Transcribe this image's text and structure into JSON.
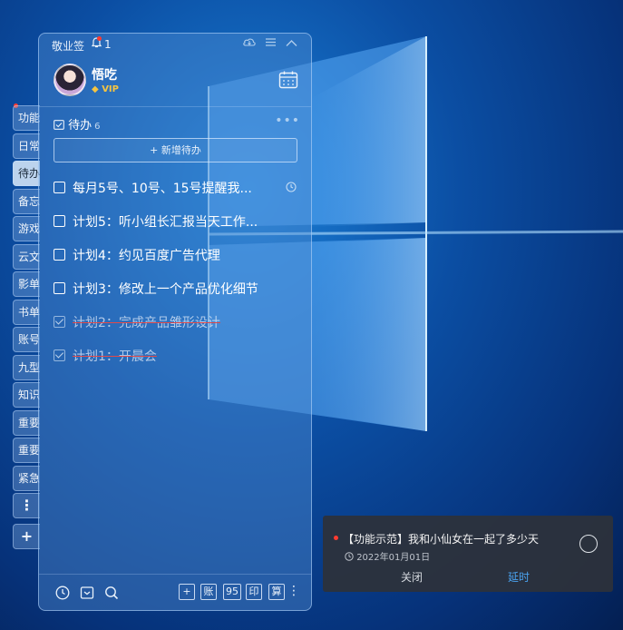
{
  "app": {
    "name": "敬业签",
    "notification_count": "1"
  },
  "profile": {
    "username": "悟吃",
    "badge": "VIP"
  },
  "side_tabs": [
    {
      "label": "功能",
      "active": false
    },
    {
      "label": "日常",
      "active": false
    },
    {
      "label": "待办",
      "active": true
    },
    {
      "label": "备忘",
      "active": false
    },
    {
      "label": "游戏",
      "active": false
    },
    {
      "label": "云文",
      "active": false
    },
    {
      "label": "影单",
      "active": false
    },
    {
      "label": "书单",
      "active": false
    },
    {
      "label": "账号",
      "active": false
    },
    {
      "label": "九型",
      "active": false
    },
    {
      "label": "知识",
      "active": false
    },
    {
      "label": "重要",
      "active": false
    },
    {
      "label": "重要",
      "active": false
    },
    {
      "label": "紧急",
      "active": false
    }
  ],
  "side_more": "⋮",
  "side_add": "+",
  "section": {
    "title": "待办",
    "count": "6",
    "add_label": "+ 新增待办"
  },
  "todos": [
    {
      "text": "每月5号、10号、15号提醒我...",
      "done": false,
      "reminder": true
    },
    {
      "text": "计划5：听小组长汇报当天工作...",
      "done": false,
      "reminder": false
    },
    {
      "text": "计划4：约见百度广告代理",
      "done": false,
      "reminder": false
    },
    {
      "text": "计划3：修改上一个产品优化细节",
      "done": false,
      "reminder": false
    },
    {
      "text": "计划2：完成产品雏形设计",
      "done": true,
      "reminder": false
    },
    {
      "text": "计划1：开晨会",
      "done": true,
      "reminder": false
    }
  ],
  "bottom_bar": {
    "add": "+",
    "ledger": "账",
    "num": "95",
    "print": "印",
    "calc": "算"
  },
  "toast": {
    "title": "【功能示范】我和小仙女在一起了多少天",
    "date": "2022年01月01日",
    "close_label": "关闭",
    "delay_label": "延时"
  },
  "colors": {
    "accent_link": "#4aa3f0",
    "alert_dot": "#ff3b30",
    "vip": "#f5c542"
  }
}
